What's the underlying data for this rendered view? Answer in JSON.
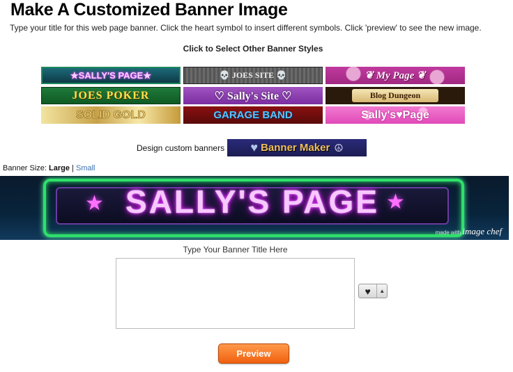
{
  "page": {
    "title": "Make A Customized Banner Image",
    "instructions": "Type your title for this web page banner. Click the heart symbol to insert different symbols. Click 'preview' to see the new image."
  },
  "styles": {
    "heading": "Click to Select Other Banner Styles",
    "items": [
      {
        "label": "★SALLY'S PAGE★"
      },
      {
        "label": "💀 JOES SITE 💀"
      },
      {
        "label": "❦ My Page ❦"
      },
      {
        "label": "JOES POKER"
      },
      {
        "label": "♡ Sally's Site ♡"
      },
      {
        "label": "Blog Dungeon"
      },
      {
        "label": "SOLID GOLD"
      },
      {
        "label": "GARAGE BAND"
      },
      {
        "label": "Sally's♥Page"
      }
    ]
  },
  "design": {
    "label": "Design custom banners",
    "button_text": "Banner Maker",
    "heart_icon": "♥",
    "peace_icon": "☮"
  },
  "size": {
    "label": "Banner Size:",
    "selected": "Large",
    "separator": "|",
    "other": "Small"
  },
  "banner": {
    "title": "SALLY'S PAGE",
    "star": "★",
    "credit_prefix": "made with",
    "credit_brand": "image chef"
  },
  "input": {
    "prompt": "Type Your Banner Title Here",
    "value": ""
  },
  "symbol_picker": {
    "symbol": "♥",
    "arrow": "▲"
  },
  "preview": {
    "label": "Preview"
  },
  "colors": {
    "preview_button": "#f06010",
    "link": "#3a6fb0",
    "neon_pink": "#e040fb",
    "neon_green": "#2fe06a"
  }
}
